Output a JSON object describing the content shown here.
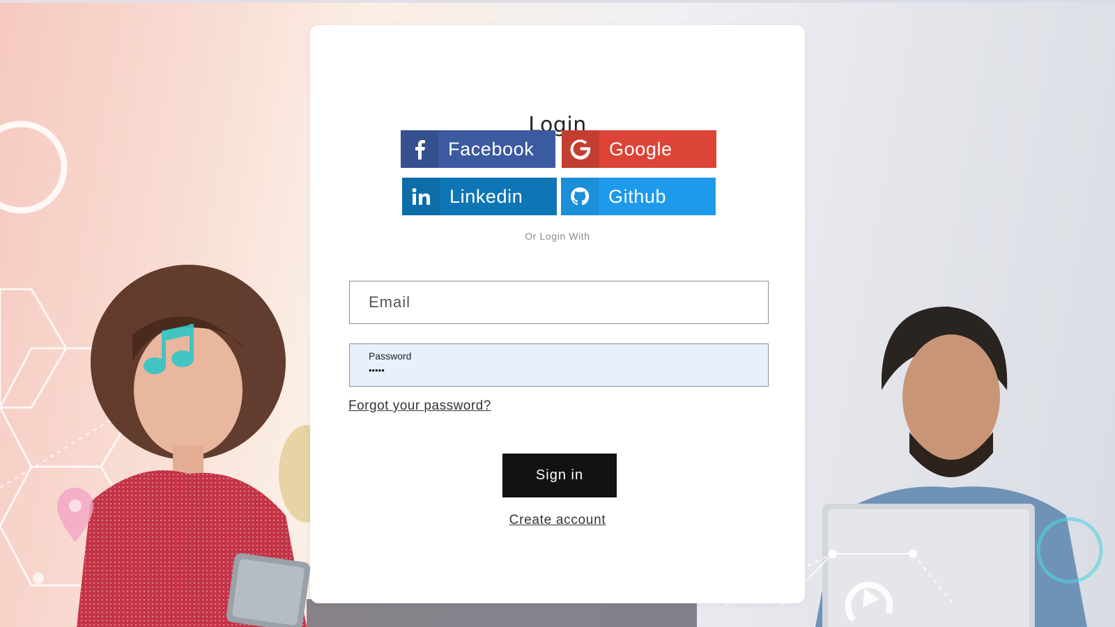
{
  "login": {
    "title": "Login",
    "social": {
      "facebook": "Facebook",
      "google": "Google",
      "linkedin": "Linkedin",
      "github": "Github"
    },
    "divider_text": "Or Login With",
    "email_placeholder": "Email",
    "password_label": "Password",
    "password_value": "•••••",
    "forgot_link": "Forgot your password?",
    "sign_in_button": "Sign in",
    "create_account_link": "Create account"
  },
  "colors": {
    "facebook": "#3b5a9f",
    "google": "#db4437",
    "linkedin": "#0f76b5",
    "github": "#1f9aea",
    "sign_in": "#121212"
  },
  "icons": [
    "facebook-icon",
    "google-icon",
    "linkedin-icon",
    "github-icon",
    "music-note-icon",
    "location-pin-icon",
    "refresh-icon"
  ]
}
